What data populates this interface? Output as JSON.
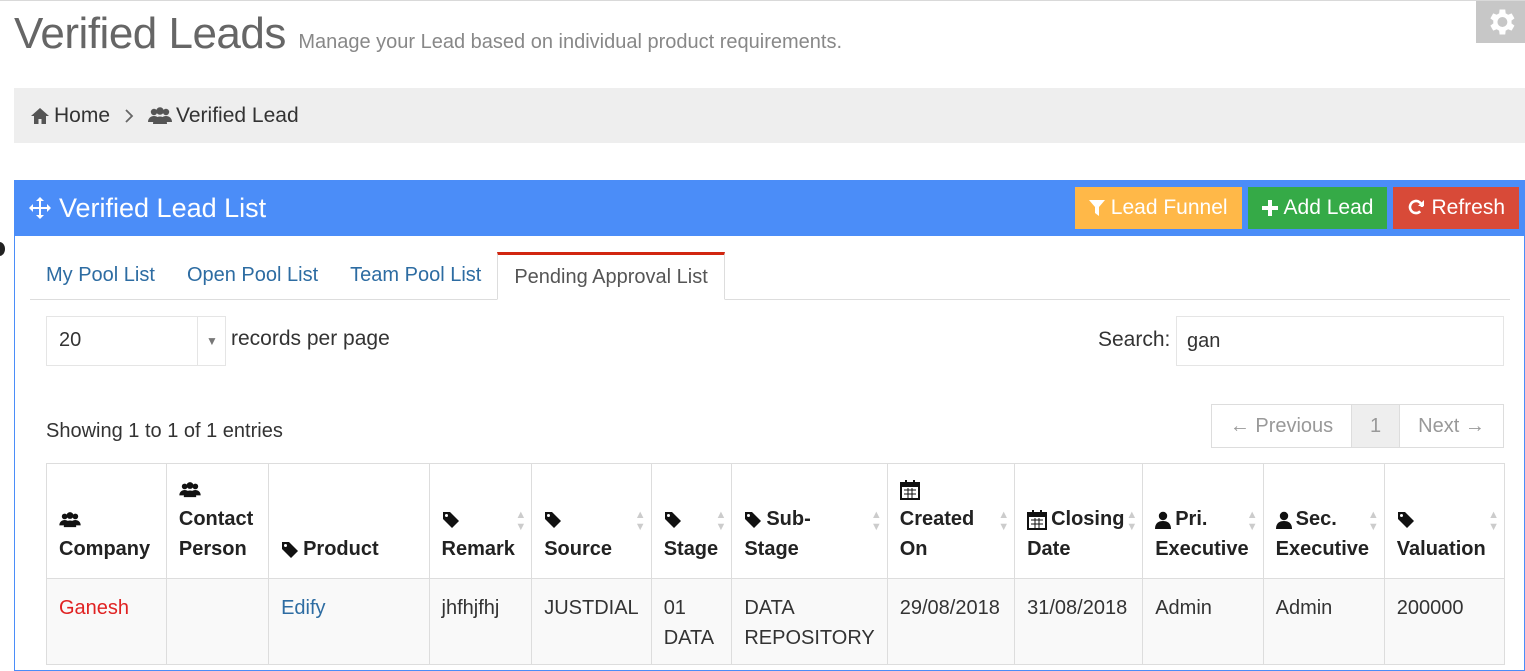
{
  "page": {
    "title": "Verified Leads",
    "subtitle": "Manage your Lead based on individual product requirements."
  },
  "breadcrumb": {
    "home": "Home",
    "current": "Verified Lead"
  },
  "portlet": {
    "title": "Verified Lead List",
    "actions": {
      "lead_funnel": "Lead Funnel",
      "add_lead": "Add Lead",
      "refresh": "Refresh"
    }
  },
  "tabs": [
    {
      "label": "My Pool List"
    },
    {
      "label": "Open Pool List"
    },
    {
      "label": "Team Pool List"
    },
    {
      "label": "Pending Approval List",
      "active": true
    }
  ],
  "table_controls": {
    "page_length": "20",
    "page_length_label": "records per page",
    "search_label": "Search:",
    "search_value": "gan",
    "info": "Showing 1 to 1 of 1 entries"
  },
  "pagination": {
    "previous": "← Previous",
    "current": "1",
    "next": "Next →"
  },
  "table": {
    "headers": [
      {
        "line1": "",
        "line2": "Company",
        "icon": "users-icon"
      },
      {
        "line1": "Contact",
        "line2": "Person",
        "icon": "users-icon"
      },
      {
        "line1": "",
        "line2": "Product",
        "icon": "tag-icon"
      },
      {
        "line1": "",
        "line2": "Remark",
        "icon": "tag-icon"
      },
      {
        "line1": "",
        "line2": "Source",
        "icon": "tag-icon"
      },
      {
        "line1": "",
        "line2": "Stage",
        "icon": "tag-icon"
      },
      {
        "line1": "Sub-",
        "line2": "Stage",
        "icon": "tag-icon"
      },
      {
        "line1": "Created",
        "line2": "On",
        "icon": "calendar-icon"
      },
      {
        "line1": "Closing",
        "line2": "Date",
        "icon": "calendar-icon"
      },
      {
        "line1": "Pri.",
        "line2": "Executive",
        "icon": "user-icon"
      },
      {
        "line1": "Sec.",
        "line2": "Executive",
        "icon": "user-icon"
      },
      {
        "line1": "",
        "line2": "Valuation",
        "icon": "tag-icon"
      }
    ],
    "rows": [
      {
        "company": "Ganesh",
        "contact_person": "",
        "product": "Edify",
        "remark": "jhfhjfhj",
        "source": "JUSTDIAL",
        "stage_line1": "01",
        "stage_line2": "DATA",
        "sub_stage_line1": "DATA",
        "sub_stage_line2": "REPOSITORY",
        "created_on": "29/08/2018",
        "closing_date": "31/08/2018",
        "pri_executive": "Admin",
        "sec_executive": "Admin",
        "valuation": "200000"
      }
    ]
  },
  "colors": {
    "portlet_blue": "#4b8df8",
    "btn_yellow": "#ffb848",
    "btn_green": "#35aa47",
    "btn_red": "#d84a38",
    "tab_active_border": "#d12610",
    "link_blue": "#2d6ca2",
    "link_red": "#e02222"
  }
}
